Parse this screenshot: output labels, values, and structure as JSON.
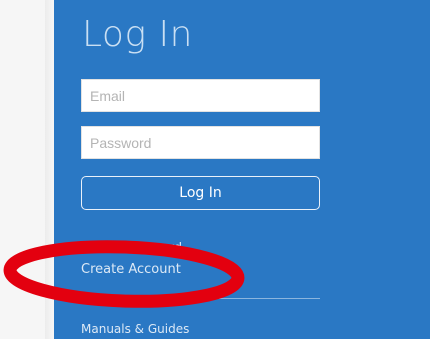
{
  "login": {
    "title": "Log In",
    "email_placeholder": "Email",
    "password_placeholder": "Password",
    "submit_label": "Log In"
  },
  "links": {
    "reset_password": "Reset Password",
    "create_account": "Create Account",
    "manuals_guides": "Manuals & Guides"
  },
  "colors": {
    "panel": "#2a78c4",
    "annotation": "#e3000f"
  }
}
